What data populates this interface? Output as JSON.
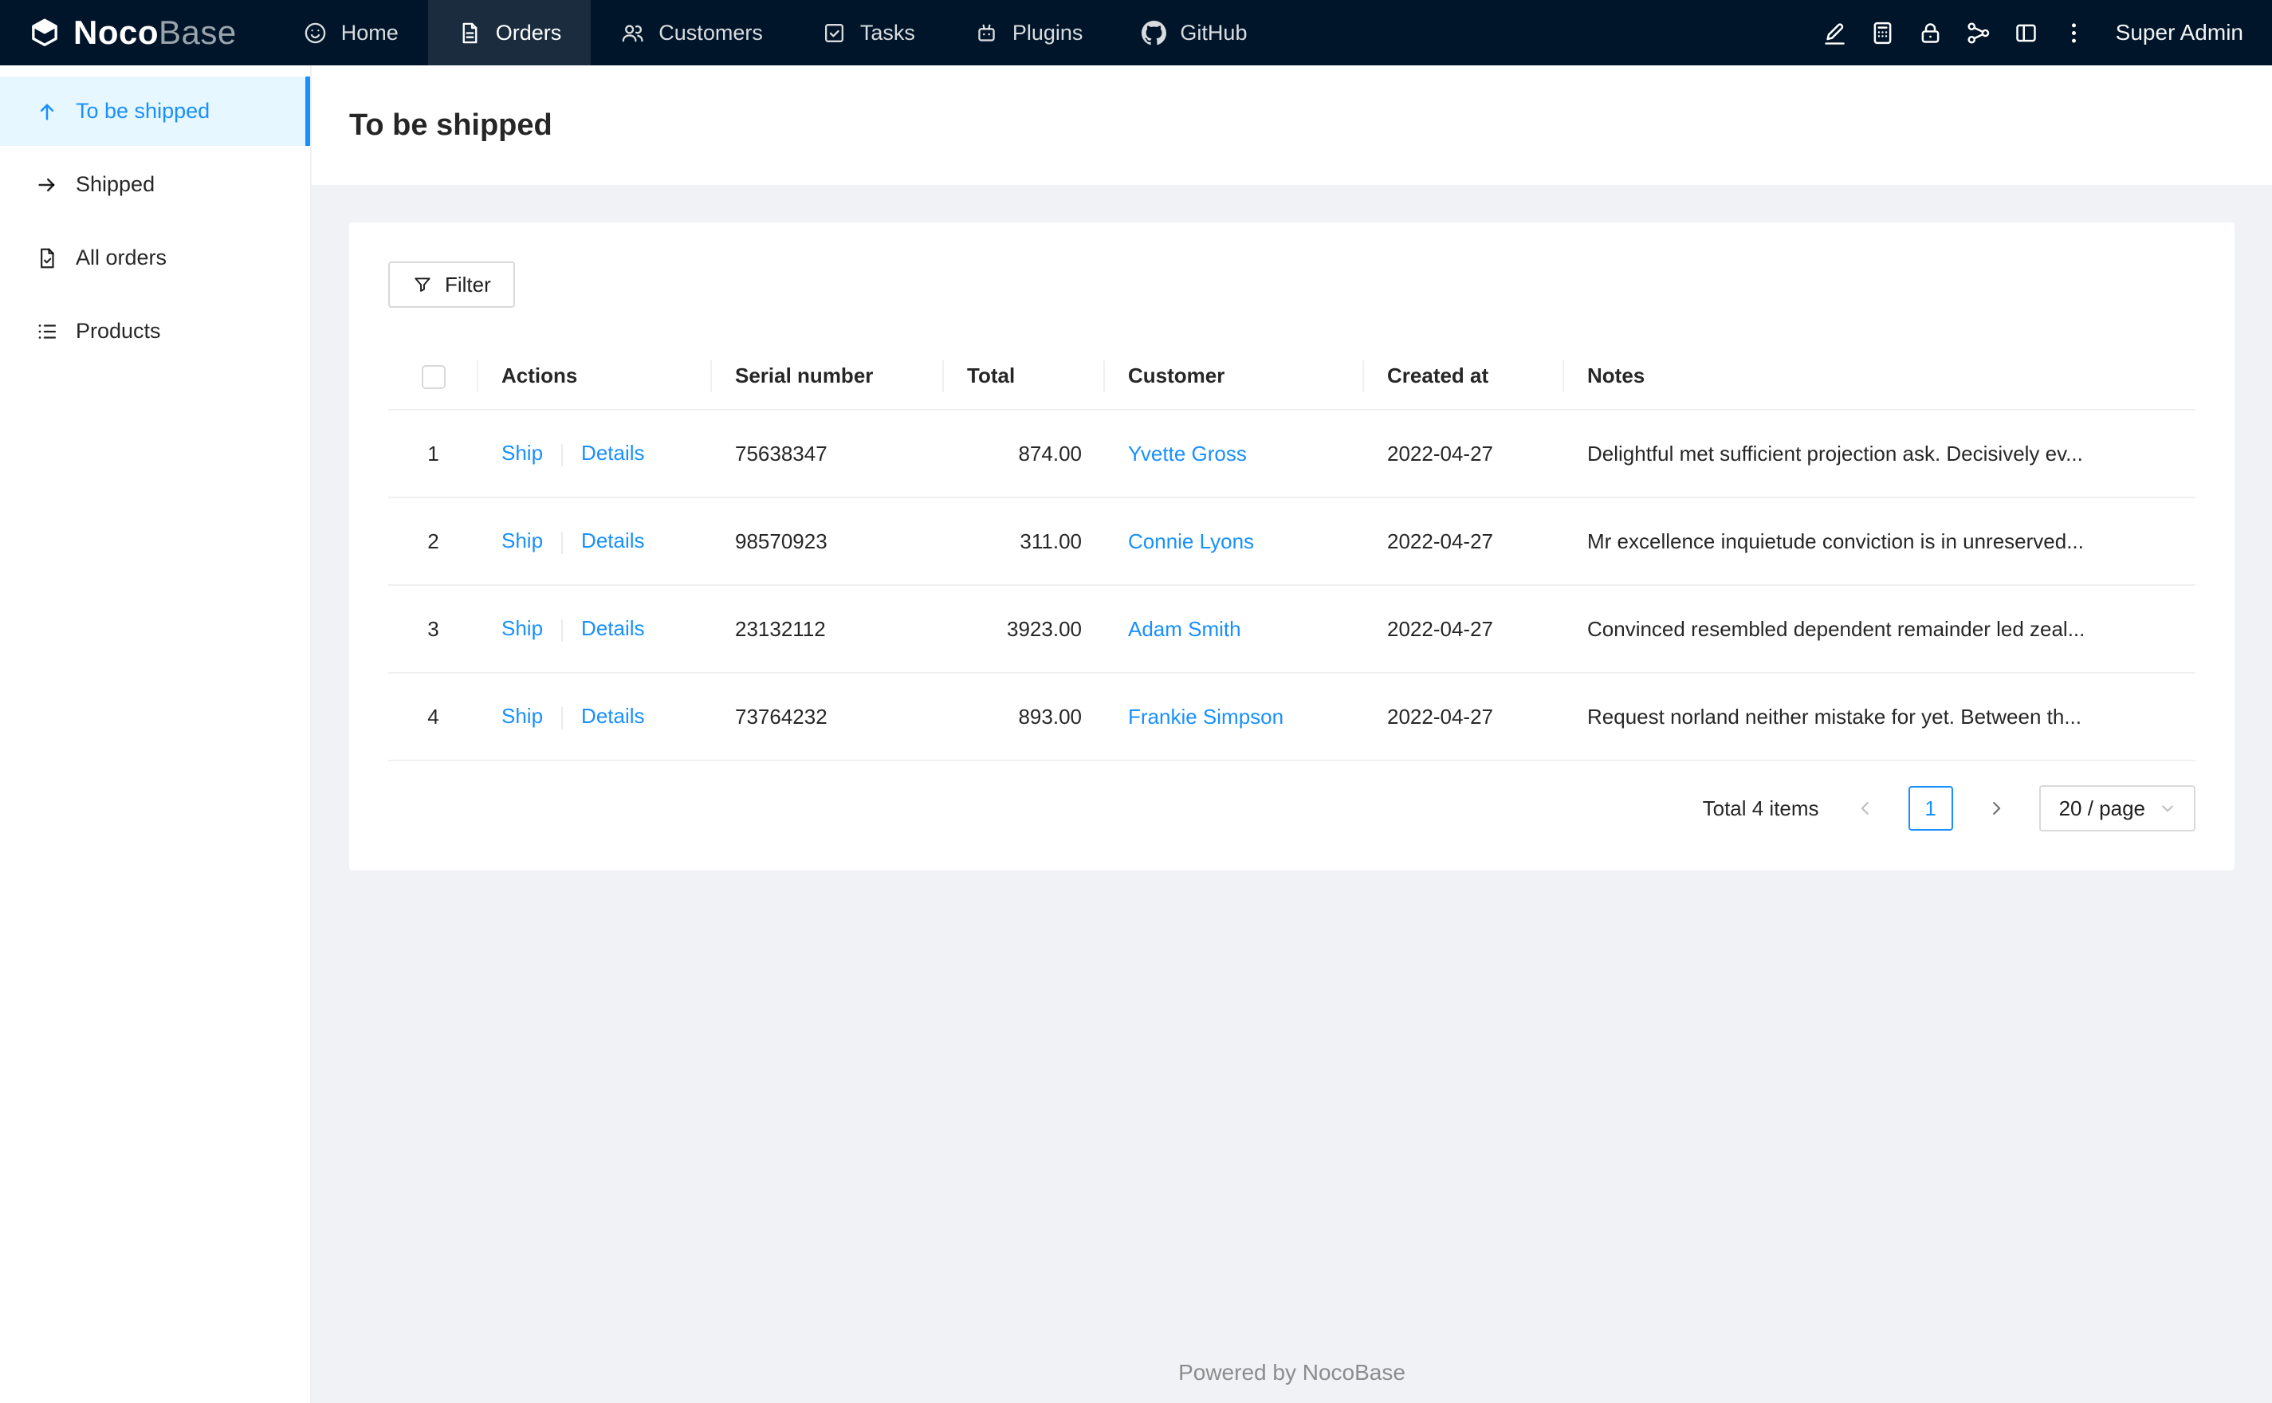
{
  "topbar": {
    "logo_noco": "Noco",
    "logo_base": "Base",
    "nav": [
      {
        "label": "Home",
        "icon": "smile-icon",
        "active": false
      },
      {
        "label": "Orders",
        "icon": "file-icon",
        "active": true
      },
      {
        "label": "Customers",
        "icon": "team-icon",
        "active": false
      },
      {
        "label": "Tasks",
        "icon": "check-square-icon",
        "active": false
      },
      {
        "label": "Plugins",
        "icon": "robot-icon",
        "active": false
      },
      {
        "label": "GitHub",
        "icon": "github-icon",
        "active": false
      }
    ],
    "action_icons": [
      "highlighter-icon",
      "calculator-icon",
      "lock-icon",
      "share-icon",
      "layout-icon",
      "more-icon"
    ],
    "user": "Super Admin"
  },
  "sidebar": {
    "items": [
      {
        "label": "To be shipped",
        "icon": "arrow-up-icon",
        "active": true
      },
      {
        "label": "Shipped",
        "icon": "arrow-right-icon",
        "active": false
      },
      {
        "label": "All orders",
        "icon": "file-done-icon",
        "active": false
      },
      {
        "label": "Products",
        "icon": "list-icon",
        "active": false
      }
    ]
  },
  "page": {
    "title": "To be shipped"
  },
  "toolbar": {
    "filter_label": "Filter"
  },
  "table": {
    "action_labels": {
      "ship": "Ship",
      "details": "Details"
    },
    "columns": [
      "Actions",
      "Serial number",
      "Total",
      "Customer",
      "Created at",
      "Notes"
    ],
    "rows": [
      {
        "index": "1",
        "serial": "75638347",
        "total": "874.00",
        "customer": "Yvette Gross",
        "created_at": "2022-04-27",
        "notes": "Delightful met sufficient projection ask. Decisively ev..."
      },
      {
        "index": "2",
        "serial": "98570923",
        "total": "311.00",
        "customer": "Connie Lyons",
        "created_at": "2022-04-27",
        "notes": "Mr excellence inquietude conviction is in unreserved..."
      },
      {
        "index": "3",
        "serial": "23132112",
        "total": "3923.00",
        "customer": "Adam Smith",
        "created_at": "2022-04-27",
        "notes": "Convinced resembled dependent remainder led zeal..."
      },
      {
        "index": "4",
        "serial": "73764232",
        "total": "893.00",
        "customer": "Frankie Simpson",
        "created_at": "2022-04-27",
        "notes": "Request norland neither mistake for yet. Between th..."
      }
    ]
  },
  "pagination": {
    "total_text": "Total 4 items",
    "current_page": "1",
    "page_size": "20 / page"
  },
  "footer": {
    "text": "Powered by NocoBase"
  },
  "colors": {
    "topbar_bg": "#001529",
    "accent": "#1890ff",
    "active_item_bg": "#e6f7ff",
    "content_bg": "#f0f2f5"
  }
}
